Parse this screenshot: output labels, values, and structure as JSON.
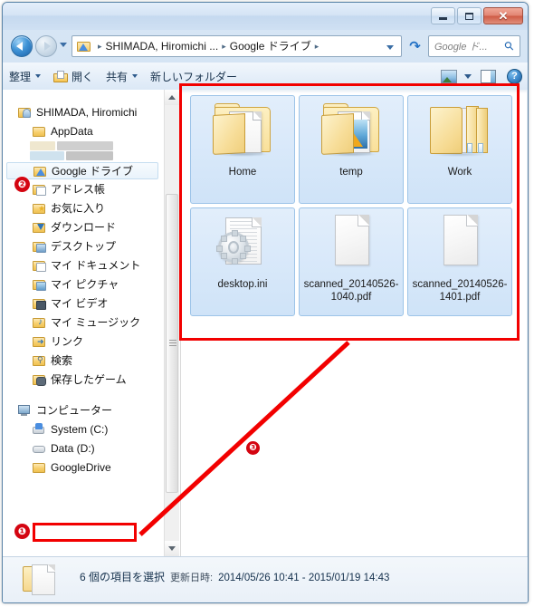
{
  "window": {
    "controls": {
      "minimize_label": "–",
      "maximize_label": "□",
      "close_label": "✕"
    }
  },
  "address": {
    "breadcrumbs": [
      {
        "label": "SHIMADA, Hiromichi ..."
      },
      {
        "label": "Google ドライブ"
      }
    ],
    "separator": "▸",
    "dropdown_icon": "chevron-down-icon",
    "refresh_icon": "refresh-icon"
  },
  "search": {
    "placeholder": "Google ド...",
    "icon": "search-icon"
  },
  "toolbar": {
    "organize_label": "整理",
    "open_label": "開く",
    "share_label": "共有",
    "new_folder_label": "新しいフォルダー",
    "view_icon": "view-layout-icon",
    "preview_pane_icon": "preview-pane-icon",
    "help_icon": "help-icon"
  },
  "sidebar": {
    "items": [
      {
        "label": "SHIMADA, Hiromichi",
        "level": 0,
        "icon": "user-folder-icon",
        "selected": false
      },
      {
        "label": "AppData",
        "level": 1,
        "icon": "folder-icon",
        "selected": false
      },
      {
        "label": "",
        "level": 1,
        "icon": "redacted",
        "selected": false
      },
      {
        "label": "Google ドライブ",
        "level": 1,
        "icon": "google-drive-folder-icon",
        "selected": true
      },
      {
        "label": "アドレス帳",
        "level": 1,
        "icon": "contacts-folder-icon",
        "selected": false
      },
      {
        "label": "お気に入り",
        "level": 1,
        "icon": "favorites-folder-icon",
        "selected": false
      },
      {
        "label": "ダウンロード",
        "level": 1,
        "icon": "downloads-folder-icon",
        "selected": false
      },
      {
        "label": "デスクトップ",
        "level": 1,
        "icon": "desktop-folder-icon",
        "selected": false
      },
      {
        "label": "マイ ドキュメント",
        "level": 1,
        "icon": "documents-folder-icon",
        "selected": false
      },
      {
        "label": "マイ ピクチャ",
        "level": 1,
        "icon": "pictures-folder-icon",
        "selected": false
      },
      {
        "label": "マイ ビデオ",
        "level": 1,
        "icon": "videos-folder-icon",
        "selected": false
      },
      {
        "label": "マイ ミュージック",
        "level": 1,
        "icon": "music-folder-icon",
        "selected": false
      },
      {
        "label": "リンク",
        "level": 1,
        "icon": "links-folder-icon",
        "selected": false
      },
      {
        "label": "検索",
        "level": 1,
        "icon": "searches-folder-icon",
        "selected": false
      },
      {
        "label": "保存したゲーム",
        "level": 1,
        "icon": "saved-games-folder-icon",
        "selected": false
      }
    ],
    "computer": [
      {
        "label": "コンピューター",
        "level": 0,
        "icon": "computer-icon",
        "selected": false
      },
      {
        "label": "System (C:)",
        "level": 1,
        "icon": "system-drive-icon",
        "selected": false
      },
      {
        "label": "Data (D:)",
        "level": 1,
        "icon": "drive-icon",
        "selected": false
      },
      {
        "label": "GoogleDrive",
        "level": 1,
        "icon": "folder-icon",
        "selected": false
      }
    ]
  },
  "content": {
    "items": [
      {
        "name": "Home",
        "icon": "folder-icon",
        "selected": true
      },
      {
        "name": "temp",
        "icon": "folder-with-image-icon",
        "selected": true
      },
      {
        "name": "Work",
        "icon": "multi-folder-icon",
        "selected": true
      },
      {
        "name": "desktop.ini",
        "icon": "ini-file-icon",
        "selected": true
      },
      {
        "name": "scanned_20140526-1040.pdf",
        "icon": "pdf-file-icon",
        "selected": true
      },
      {
        "name": "scanned_20140526-1401.pdf",
        "icon": "pdf-file-icon",
        "selected": true
      }
    ]
  },
  "status": {
    "count_text": "6 個の項目を選択",
    "date_label": "更新日時:",
    "date_value": "2014/05/26 10:41 - 2015/01/19 14:43"
  },
  "annotations": {
    "badge_1": "❶",
    "badge_2": "❷",
    "badge_3": "❸",
    "color": "#f20000"
  }
}
